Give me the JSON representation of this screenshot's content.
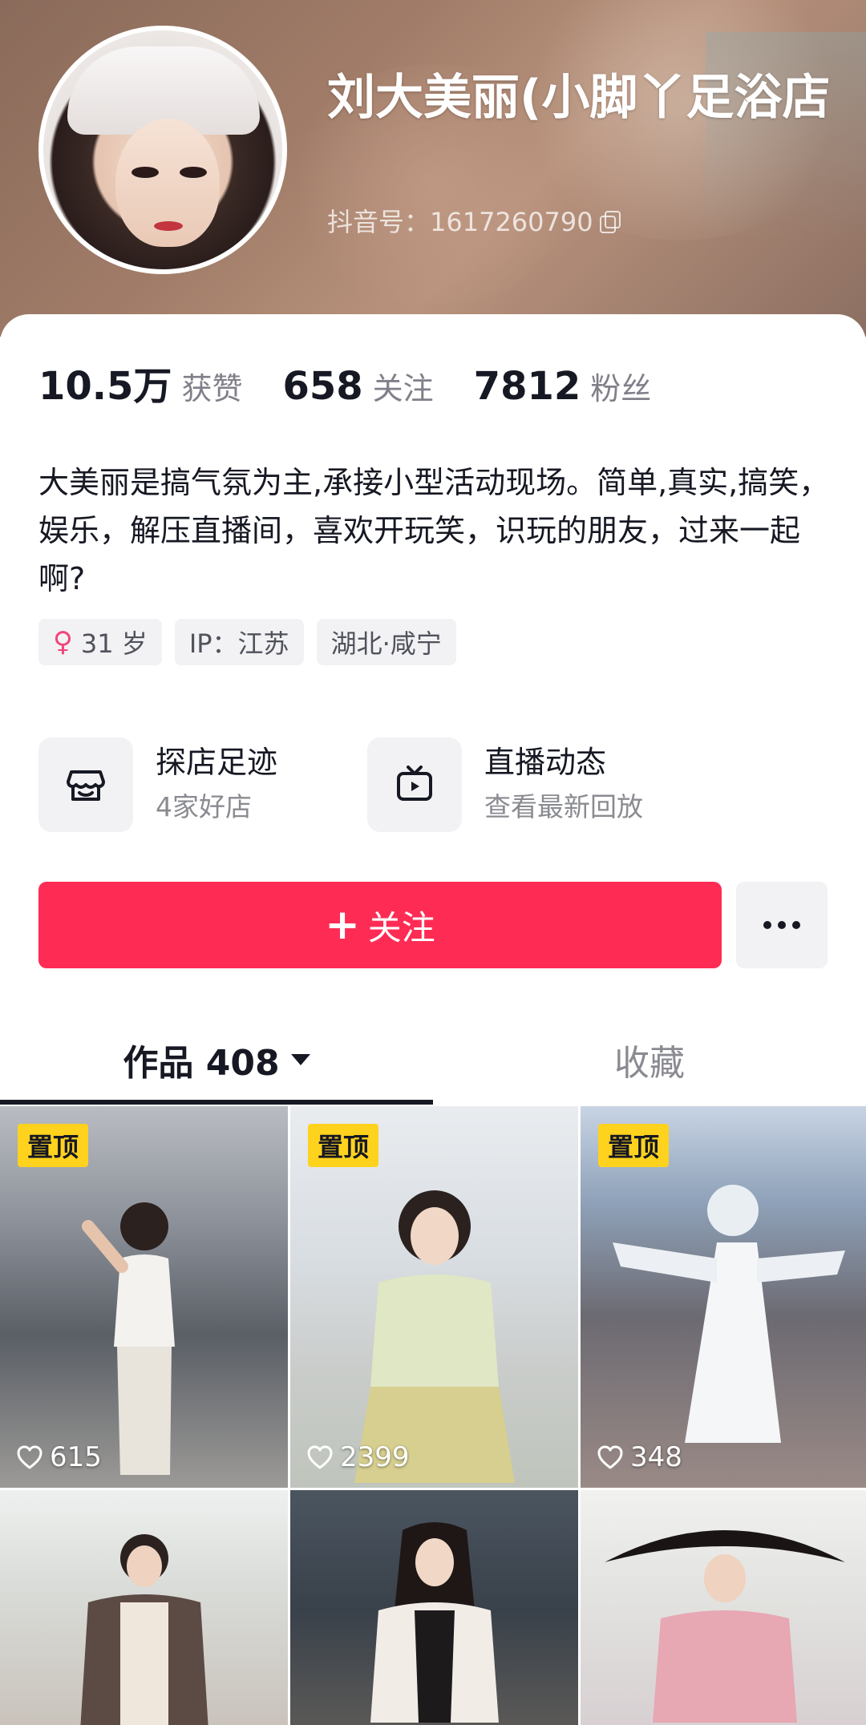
{
  "profile": {
    "name": "刘大美丽(小脚丫足浴店",
    "douyin_id": "抖音号：1617260790"
  },
  "stats": [
    {
      "value": "10.5万",
      "label": "获赞"
    },
    {
      "value": "658",
      "label": "关注"
    },
    {
      "value": "7812",
      "label": "粉丝"
    }
  ],
  "bio": "大美丽是搞气氛为主,承接小型活动现场。简单,真实,搞笑，娱乐，解压直播间，喜欢开玩笑，识玩的朋友，过来一起啊?",
  "tags": {
    "age": "31 岁",
    "ip": "IP：江苏",
    "location": "湖北·咸宁"
  },
  "features": [
    {
      "title": "探店足迹",
      "subtitle": "4家好店",
      "icon": "shop-icon"
    },
    {
      "title": "直播动态",
      "subtitle": "查看最新回放",
      "icon": "tv-icon"
    }
  ],
  "actions": {
    "follow_label": "关注",
    "more_icon": "more-dots-icon"
  },
  "tabs": {
    "works_label": "作品 408",
    "favorites_label": "收藏"
  },
  "videos": [
    {
      "pinned_label": "置顶",
      "likes": "615"
    },
    {
      "pinned_label": "置顶",
      "likes": "2399"
    },
    {
      "pinned_label": "置顶",
      "likes": "348"
    },
    {
      "pinned_label": "",
      "likes": ""
    },
    {
      "pinned_label": "",
      "likes": ""
    },
    {
      "pinned_label": "",
      "likes": ""
    }
  ],
  "colors": {
    "accent": "#fe2c55",
    "pin": "#ffd21e",
    "female": "#f0467a"
  }
}
